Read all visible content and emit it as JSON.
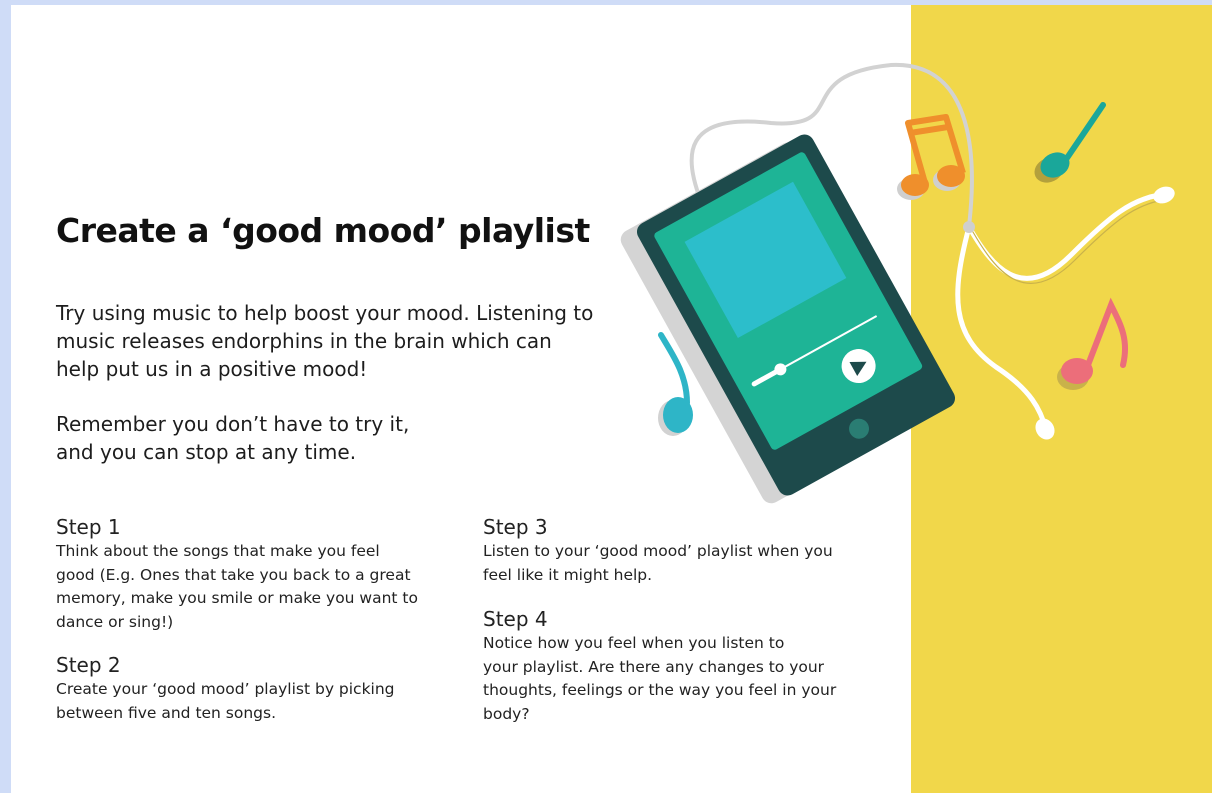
{
  "title": "Create a ‘good mood’ playlist",
  "intro": {
    "lines1": [
      "Try using music to help boost your mood. Listening to",
      "music releases endorphins in the brain which can",
      "help put us in a positive mood!"
    ],
    "lines2": [
      "Remember you don’t have to try it,",
      "and you can stop at any time."
    ]
  },
  "steps": [
    {
      "title": "Step 1",
      "lines": [
        "Think about the songs that make you feel",
        "good (E.g. Ones that take you back to a great",
        "memory, make you smile or make you want to",
        "dance or sing!)"
      ]
    },
    {
      "title": "Step 2",
      "lines": [
        "Create your ‘good mood’ playlist by picking",
        "between five and ten songs."
      ]
    },
    {
      "title": "Step 3",
      "lines": [
        "Listen to your ‘good mood’ playlist when you",
        "feel like it might help."
      ]
    },
    {
      "title": "Step 4",
      "lines": [
        "Notice how you feel when you listen to",
        "your playlist. Are there any changes to your",
        "thoughts, feelings or the way you feel in your",
        "body?"
      ]
    }
  ],
  "illustration": {
    "icons": [
      "music-player-icon",
      "earphones-icon",
      "music-note-icon",
      "play-icon"
    ],
    "colors": {
      "panel": "#f1d74a",
      "player_body": "#1d4a4b",
      "player_screen": "#1eb496",
      "note_orange": "#ef8f2c",
      "note_teal": "#1aa79a",
      "note_blue": "#2eb5c7",
      "note_pink": "#ec6e7a"
    }
  }
}
